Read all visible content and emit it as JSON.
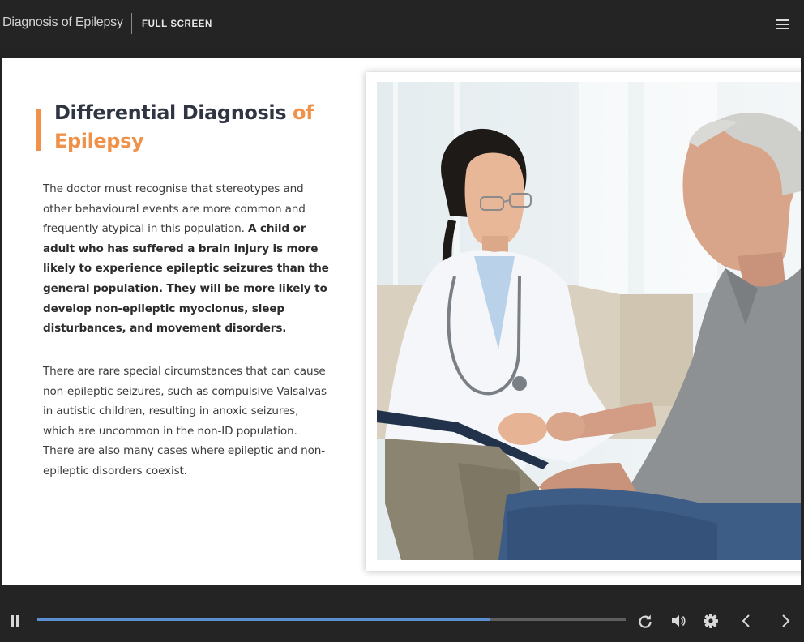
{
  "header": {
    "course_title": "Diagnosis of Epilepsy",
    "fullscreen_label": "FULL SCREEN",
    "menu_icon": "hamburger-menu-icon"
  },
  "slide": {
    "title_main": "Differential Diagnosis ",
    "title_highlight_of": "of",
    "title_highlight_word": "Epilepsy",
    "paragraph1_regular": "The doctor must recognise that stereotypes and other behavioural events are more common and frequently atypical in this population. ",
    "paragraph1_bold": "A child or adult who has suffered a brain injury is more likely to experience epileptic seizures than the general population. They will be more likely to develop non-epileptic myoclonus, sleep disturbances, and movement disorders.",
    "paragraph2": "There are rare special circumstances that can cause non-epileptic seizures, such as compulsive Valsalvas in autistic children, resulting in anoxic seizures, which are uncommon in the non-ID population. There are also many cases where epileptic and non-epileptic disorders coexist.",
    "image_subject": "doctor-consulting-patient-photo"
  },
  "player": {
    "progress": 0.77,
    "icons": {
      "pause": "pause-icon",
      "replay": "replay-icon",
      "volume": "volume-icon",
      "settings": "gear-icon",
      "previous": "chevron-left-icon",
      "next": "chevron-right-icon"
    }
  },
  "colors": {
    "accent": "#f0914a",
    "heading": "#2f3542",
    "progress": "#5b8fd0",
    "chrome": "#242424"
  }
}
